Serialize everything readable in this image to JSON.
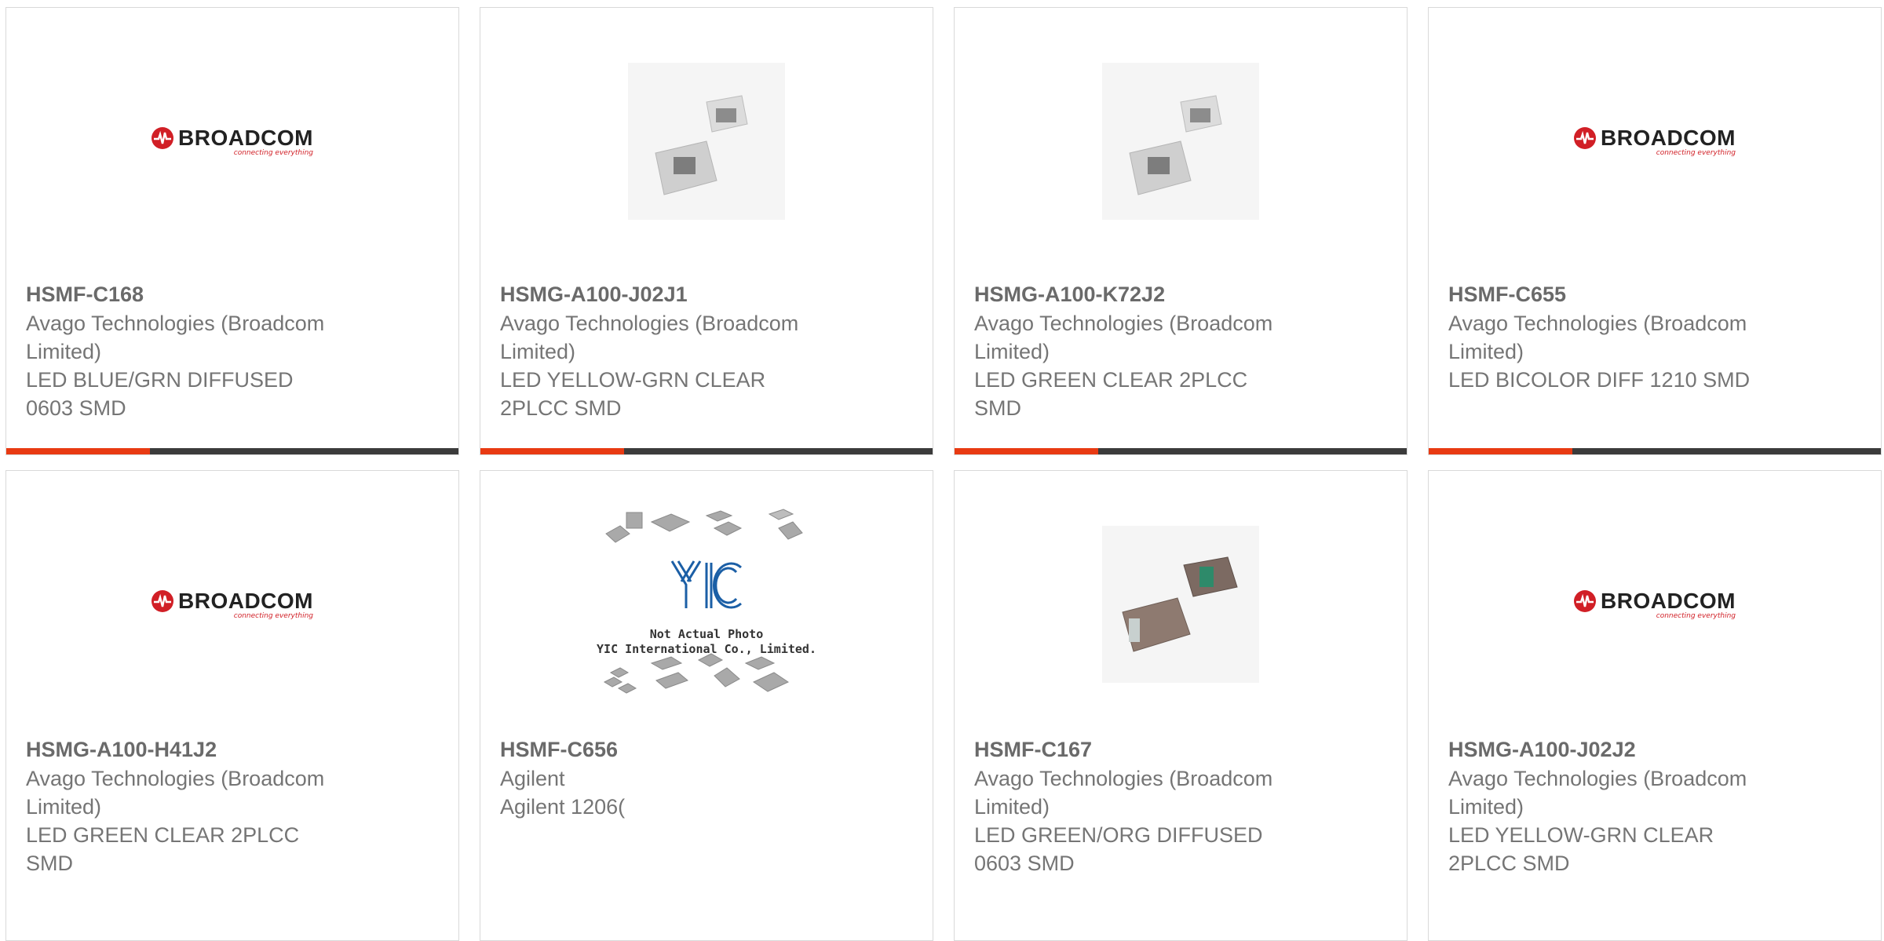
{
  "colors": {
    "accent": "#e83a12",
    "bar": "#3b3b3b",
    "broadcom_red": "#d11f26",
    "yic_blue": "#1b5fa6"
  },
  "cards": [
    {
      "part": "HSMF-C168",
      "maker_line1": "Avago Technologies (Broadcom",
      "maker_line2": "Limited)",
      "desc_line1": "LED BLUE/GRN DIFFUSED",
      "desc_line2": "0603 SMD",
      "image": "broadcom-logo"
    },
    {
      "part": "HSMG-A100-J02J1",
      "maker_line1": "Avago Technologies (Broadcom",
      "maker_line2": "Limited)",
      "desc_line1": "LED YELLOW-GRN CLEAR",
      "desc_line2": "2PLCC SMD",
      "image": "led-photo"
    },
    {
      "part": "HSMG-A100-K72J2",
      "maker_line1": "Avago Technologies (Broadcom",
      "maker_line2": "Limited)",
      "desc_line1": "LED GREEN CLEAR 2PLCC",
      "desc_line2": "SMD",
      "image": "led-photo"
    },
    {
      "part": "HSMF-C655",
      "maker_line1": "Avago Technologies (Broadcom",
      "maker_line2": "Limited)",
      "desc_line1": "LED BICOLOR DIFF 1210 SMD",
      "desc_line2": "",
      "image": "broadcom-logo"
    },
    {
      "part": "HSMG-A100-H41J2",
      "maker_line1": "Avago Technologies (Broadcom",
      "maker_line2": "Limited)",
      "desc_line1": "LED GREEN CLEAR 2PLCC",
      "desc_line2": "SMD",
      "image": "broadcom-logo"
    },
    {
      "part": "HSMF-C656",
      "maker_line1": "Agilent",
      "maker_line2": "",
      "desc_line1": "Agilent 1206(",
      "desc_line2": "",
      "image": "yic-placeholder"
    },
    {
      "part": "HSMF-C167",
      "maker_line1": "Avago Technologies (Broadcom",
      "maker_line2": "Limited)",
      "desc_line1": "LED GREEN/ORG DIFFUSED",
      "desc_line2": "0603 SMD",
      "image": "led-photo-0603"
    },
    {
      "part": "HSMG-A100-J02J2",
      "maker_line1": "Avago Technologies (Broadcom",
      "maker_line2": "Limited)",
      "desc_line1": "LED YELLOW-GRN CLEAR",
      "desc_line2": "2PLCC SMD",
      "image": "broadcom-logo"
    }
  ],
  "logo": {
    "brand": "BROADCOM",
    "tagline": "connecting everything"
  },
  "yic": {
    "mark": "YIC",
    "line1": "Not Actual Photo",
    "line2": "YIC International Co., Limited."
  }
}
